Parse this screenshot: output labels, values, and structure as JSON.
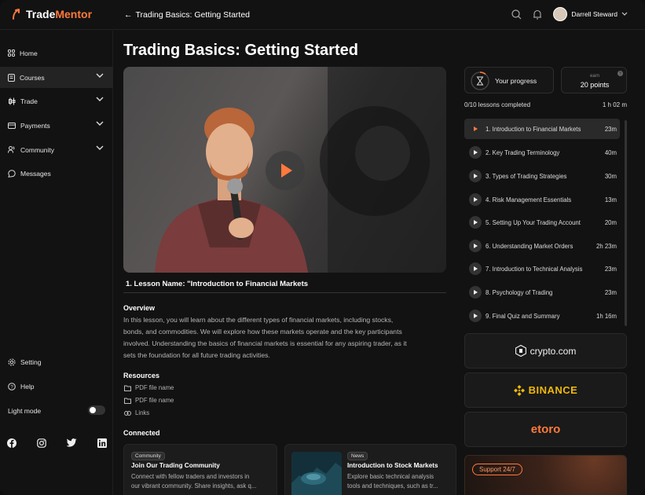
{
  "app": {
    "brand_prefix": "Trade",
    "brand_suffix": "Mentor"
  },
  "header": {
    "back_arrow": "←",
    "breadcrumb": "Trading Basics: Getting Started",
    "user_name": "Darrell Steward"
  },
  "sidebar": {
    "items": [
      {
        "label": "Home",
        "icon": "grid-icon",
        "has_chevron": false
      },
      {
        "label": "Courses",
        "icon": "book-icon",
        "has_chevron": true,
        "active": true
      },
      {
        "label": "Trade",
        "icon": "candles-icon",
        "has_chevron": true
      },
      {
        "label": "Payments",
        "icon": "card-icon",
        "has_chevron": true
      },
      {
        "label": "Community",
        "icon": "users-icon",
        "has_chevron": true
      },
      {
        "label": "Messages",
        "icon": "chat-icon",
        "has_chevron": false
      }
    ],
    "bottom": {
      "setting": "Setting",
      "help": "Help",
      "light_mode": "Light mode",
      "light_mode_on": false
    },
    "socials": [
      "facebook-icon",
      "instagram-icon",
      "twitter-icon",
      "linkedin-icon"
    ]
  },
  "main": {
    "title": "Trading Basics: Getting Started",
    "lesson_name": "1. Lesson Name: \"Introduction to Financial Markets",
    "overview_heading": "Overview",
    "overview_lines": [
      "In this lesson, you will learn about the different types of financial markets, including stocks,",
      "bonds, and commodities. We will explore how these markets operate and the key participants",
      "involved. Understanding the basics of financial markets is essential for any aspiring trader, as it",
      "sets the foundation for all future trading activities."
    ],
    "resources_heading": "Resources",
    "resources": [
      {
        "label": "PDF file name",
        "icon": "folder-icon"
      },
      {
        "label": "PDF file name",
        "icon": "folder-icon"
      },
      {
        "label": "Links",
        "icon": "link-icon"
      }
    ],
    "connected_heading": "Connected",
    "cards": [
      {
        "tag": "Community",
        "title": "Join Our Trading Community",
        "lines": [
          "Connect with fellow traders and investors in",
          "our vibrant community. Share insights, ask q..."
        ]
      },
      {
        "tag": "News",
        "title": "Introduction to Stock Markets",
        "lines": [
          "Explore basic technical analysis",
          "tools and techniques, such as tr..."
        ]
      }
    ]
  },
  "progress": {
    "label": "Your progress",
    "earn_label": "earn",
    "points": "20 points",
    "completed": "0/10 lessons completed",
    "total_time": "1 h 02 m"
  },
  "lessons": [
    {
      "title": "1. Introduction to Financial Markets",
      "duration": "23m",
      "active": true
    },
    {
      "title": "2. Key Trading Terminology",
      "duration": "40m"
    },
    {
      "title": "3. Types of Trading Strategies",
      "duration": "30m"
    },
    {
      "title": "4. Risk Management Essentials",
      "duration": "13m"
    },
    {
      "title": "5. Setting Up Your Trading Account",
      "duration": "20m"
    },
    {
      "title": "6. Understanding Market Orders",
      "duration": "2h 23m"
    },
    {
      "title": "7. Introduction to Technical Analysis",
      "duration": "23m"
    },
    {
      "title": "8. Psychology of Trading",
      "duration": "23m"
    },
    {
      "title": "9. Final Quiz and Summary",
      "duration": "1h 16m"
    }
  ],
  "partners": {
    "crypto": "crypto.com",
    "binance": "BINANCE",
    "etoro": "etoro"
  },
  "support": {
    "label": "Support 24/7"
  },
  "colors": {
    "accent": "#ff7a3c",
    "binance": "#f0b90b",
    "background": "#121212"
  }
}
